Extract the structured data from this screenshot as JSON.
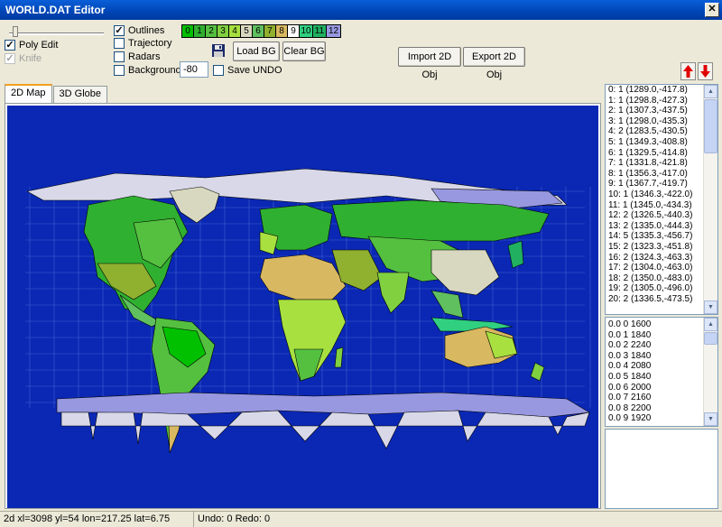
{
  "window": {
    "title": "WORLD.DAT Editor",
    "close_glyph": "✕"
  },
  "controls": {
    "poly_edit": {
      "label": "Poly Edit",
      "checked": true
    },
    "knife": {
      "label": "Knife",
      "checked": false,
      "disabled": true
    },
    "outlines": {
      "label": "Outlines",
      "checked": true
    },
    "trajectory": {
      "label": "Trajectory",
      "checked": false
    },
    "radars": {
      "label": "Radars",
      "checked": false
    },
    "background": {
      "label": "Background",
      "checked": false,
      "value": "-80"
    },
    "save_undo": {
      "label": "Save UNDO",
      "checked": false
    },
    "load_bg": "Load BG",
    "clear_bg": "Clear BG",
    "import_2d": "Import 2D Obj",
    "export_2d": "Export 2D Obj",
    "save_icon": "floppy-disk-icon",
    "up_icon": "arrow-up-icon",
    "down_icon": "arrow-down-icon",
    "up_color": "#e00000",
    "down_color": "#e00000"
  },
  "palette": [
    {
      "label": "0",
      "color": "#00c000"
    },
    {
      "label": "1",
      "color": "#30b030"
    },
    {
      "label": "2",
      "color": "#55c040"
    },
    {
      "label": "3",
      "color": "#80d040"
    },
    {
      "label": "4",
      "color": "#a8e040"
    },
    {
      "label": "5",
      "color": "#d8d8c0"
    },
    {
      "label": "6",
      "color": "#60c060"
    },
    {
      "label": "7",
      "color": "#90b030"
    },
    {
      "label": "8",
      "color": "#d8b860"
    },
    {
      "label": "9",
      "color": "#ffffff"
    },
    {
      "label": "10",
      "color": "#30d080"
    },
    {
      "label": "11",
      "color": "#20b060"
    },
    {
      "label": "12",
      "color": "#9898e0"
    }
  ],
  "tabs": [
    "2D Map",
    "3D Globe"
  ],
  "map_colors": {
    "ocean": "#0a28b4",
    "grid": "#5a7ad8"
  },
  "object_list": [
    "0: 1 (1289.0,-417.8)",
    "1: 1 (1298.8,-427.3)",
    "2: 1 (1307.3,-437.5)",
    "3: 1 (1298.0,-435.3)",
    "4: 2 (1283.5,-430.5)",
    "5: 1 (1349.3,-408.8)",
    "6: 1 (1329.5,-414.8)",
    "7: 1 (1331.8,-421.8)",
    "8: 1 (1356.3,-417.0)",
    "9: 1 (1367.7,-419.7)",
    "10: 1 (1346.3,-422.0)",
    "11: 1 (1345.0,-434.3)",
    "12: 2 (1326.5,-440.3)",
    "13: 2 (1335.0,-444.3)",
    "14: 5 (1335.3,-456.7)",
    "15: 2 (1323.3,-451.8)",
    "16: 2 (1324.3,-463.3)",
    "17: 2 (1304.0,-463.0)",
    "18: 2 (1350.0,-483.0)",
    "19: 2 (1305.0,-496.0)",
    "20: 2 (1336.5,-473.5)"
  ],
  "value_list": [
    "0.0 0 1600",
    "0.0 1 1840",
    "0.0 2 2240",
    "0.0 3 1840",
    "0.0 4 2080",
    "0.0 5 1840",
    "0.0 6 2000",
    "0.0 7 2160",
    "0.0 8 2200",
    "0.0 9 1920"
  ],
  "status": {
    "coords": "2d xl=3098 yl=54 lon=217.25 lat=6.75",
    "undo": "Undo: 0 Redo: 0"
  }
}
